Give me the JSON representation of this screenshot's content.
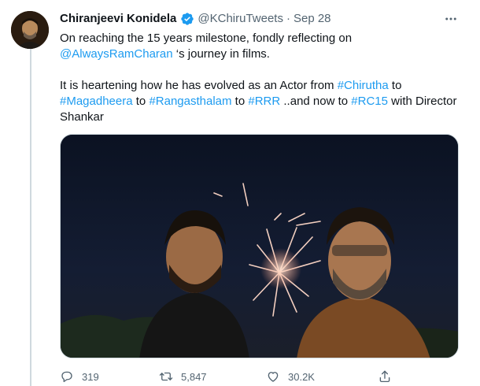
{
  "author": {
    "display_name": "Chiranjeevi Konidela",
    "handle": "@KChiruTweets",
    "separator": "·",
    "date": "Sep 28",
    "verified": true
  },
  "tweet": {
    "line1": "On reaching the 15 years milestone, fondly reflecting on",
    "mention": "@AlwaysRamCharan",
    "line2_rest": " ‘s journey in films.",
    "p2_part1": "It is heartening how he has evolved as an Actor from ",
    "hashtag1": "#Chirutha",
    "p2_to1": " to",
    "hashtag2": "#Magadheera",
    "p2_to2": " to ",
    "hashtag3": "#Rangasthalam",
    "p2_to3": " to ",
    "hashtag4": "#RRR",
    "p2_and": " ..and now to ",
    "hashtag5": "#RC15",
    "p2_end": " with Director",
    "p2_last": "Shankar"
  },
  "actions": {
    "reply_count": "319",
    "retweet_count": "5,847",
    "like_count": "30.2K"
  },
  "icons": {
    "more": "more-horizontal-icon",
    "verified": "verified-badge-icon",
    "reply": "reply-icon",
    "retweet": "retweet-icon",
    "like": "heart-icon",
    "share": "share-icon"
  },
  "colors": {
    "link": "#1d9bf0",
    "secondary_text": "#536471",
    "primary_text": "#0f1419",
    "thread_line": "#cfd9de"
  }
}
